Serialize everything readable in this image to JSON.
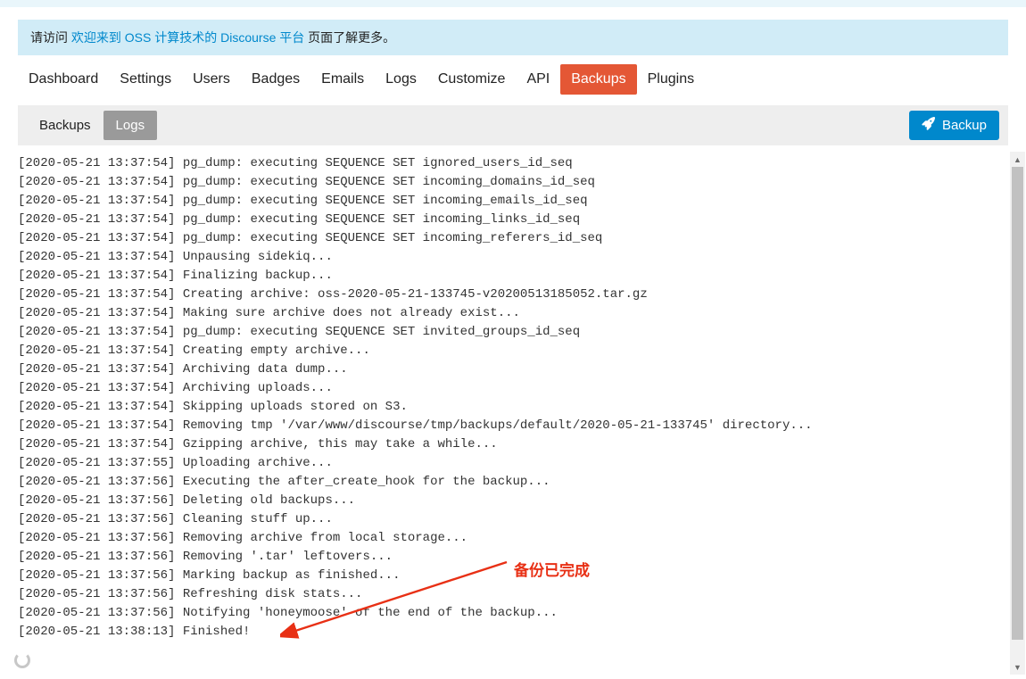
{
  "notice": {
    "prefix": "请访问 ",
    "link_text": "欢迎来到 OSS 计算技术的 Discourse 平台",
    "suffix": " 页面了解更多。"
  },
  "main_nav": {
    "items": [
      "Dashboard",
      "Settings",
      "Users",
      "Badges",
      "Emails",
      "Logs",
      "Customize",
      "API",
      "Backups",
      "Plugins"
    ],
    "active": "Backups"
  },
  "sub_tabs": {
    "items": [
      "Backups",
      "Logs"
    ],
    "active": "Logs"
  },
  "backup_button": {
    "label": "Backup"
  },
  "annotation_text": "备份已完成",
  "logs": [
    "[2020-05-21 13:37:54] pg_dump: executing SEQUENCE SET ignored_users_id_seq",
    "[2020-05-21 13:37:54] pg_dump: executing SEQUENCE SET incoming_domains_id_seq",
    "[2020-05-21 13:37:54] pg_dump: executing SEQUENCE SET incoming_emails_id_seq",
    "[2020-05-21 13:37:54] pg_dump: executing SEQUENCE SET incoming_links_id_seq",
    "[2020-05-21 13:37:54] pg_dump: executing SEQUENCE SET incoming_referers_id_seq",
    "[2020-05-21 13:37:54] Unpausing sidekiq...",
    "[2020-05-21 13:37:54] Finalizing backup...",
    "[2020-05-21 13:37:54] Creating archive: oss-2020-05-21-133745-v20200513185052.tar.gz",
    "[2020-05-21 13:37:54] Making sure archive does not already exist...",
    "[2020-05-21 13:37:54] pg_dump: executing SEQUENCE SET invited_groups_id_seq",
    "[2020-05-21 13:37:54] Creating empty archive...",
    "[2020-05-21 13:37:54] Archiving data dump...",
    "[2020-05-21 13:37:54] Archiving uploads...",
    "[2020-05-21 13:37:54] Skipping uploads stored on S3.",
    "[2020-05-21 13:37:54] Removing tmp '/var/www/discourse/tmp/backups/default/2020-05-21-133745' directory...",
    "[2020-05-21 13:37:54] Gzipping archive, this may take a while...",
    "[2020-05-21 13:37:55] Uploading archive...",
    "[2020-05-21 13:37:56] Executing the after_create_hook for the backup...",
    "[2020-05-21 13:37:56] Deleting old backups...",
    "[2020-05-21 13:37:56] Cleaning stuff up...",
    "[2020-05-21 13:37:56] Removing archive from local storage...",
    "[2020-05-21 13:37:56] Removing '.tar' leftovers...",
    "[2020-05-21 13:37:56] Marking backup as finished...",
    "[2020-05-21 13:37:56] Refreshing disk stats...",
    "[2020-05-21 13:37:56] Notifying 'honeymoose' of the end of the backup...",
    "[2020-05-21 13:38:13] Finished!"
  ]
}
